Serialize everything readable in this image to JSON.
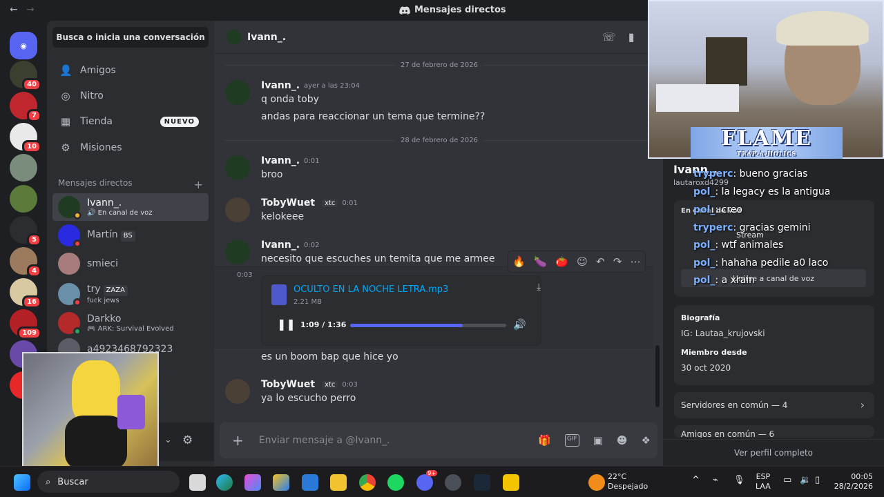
{
  "titlebar": {
    "back": "←",
    "forward": "→",
    "title": "Mensajes directos"
  },
  "servers": [
    {
      "badge": "",
      "color": "#5865f2",
      "icon": "discord-home-icon"
    },
    {
      "badge": "40",
      "color": "#3a3f2f"
    },
    {
      "badge": "7",
      "color": "#c0262d"
    },
    {
      "badge": "10",
      "color": "#e9e9e9"
    },
    {
      "badge": "",
      "color": "#7a8d7d"
    },
    {
      "badge": "",
      "color": "#5c7a3a"
    },
    {
      "badge": "5",
      "color": "#2b2d31"
    },
    {
      "badge": "4",
      "color": "#9c7a5e"
    },
    {
      "badge": "16",
      "color": "#d9c9a3"
    },
    {
      "badge": "109",
      "color": "#b32025"
    },
    {
      "badge": "",
      "color": "#6a4aa8"
    },
    {
      "badge": "",
      "color": "#e82828"
    }
  ],
  "sidebar": {
    "search": "Busca o inicia una conversación",
    "nav": [
      {
        "label": "Amigos",
        "icon": "friends-icon"
      },
      {
        "label": "Nitro",
        "icon": "nitro-icon"
      },
      {
        "label": "Tienda",
        "icon": "shop-icon",
        "badge": "NUEVO"
      },
      {
        "label": "Misiones",
        "icon": "quests-icon"
      }
    ],
    "dm_header": "Mensajes directos",
    "dm_add": "+",
    "dms": [
      {
        "name": "Ivann_.",
        "sub": "En canal de voz",
        "avatar": "#1f3b22",
        "status": "#f0b232"
      },
      {
        "name": "Martín",
        "tag": "BS",
        "sub": "",
        "avatar": "#2a2ae0",
        "status": "#f23f43"
      },
      {
        "name": "smieci",
        "sub": "",
        "avatar": "#a87c7c",
        "status": ""
      },
      {
        "name": "try",
        "tag": "ZAZA",
        "sub": "fuck jews",
        "avatar": "#6a8fa8",
        "status": "#f23f43"
      },
      {
        "name": "Darkko",
        "sub": "ARK: Survival Evolved",
        "avatar": "#b42a2a",
        "status": "#23a55a"
      },
      {
        "name": "a4923468792323",
        "sub": "",
        "avatar": "#5a5d66",
        "status": ""
      }
    ]
  },
  "chat": {
    "recipient": "Ivann_.",
    "dates": [
      "27 de febrero de 2026",
      "28 de febrero de 2026"
    ],
    "messages": [
      {
        "author": "Ivann_.",
        "time": "ayer a las 23:04",
        "lines": [
          "q onda toby",
          "andas para reaccionar un tema que termine??"
        ]
      },
      {
        "author": "Ivann_.",
        "time": "0:01",
        "lines": [
          "broo"
        ]
      },
      {
        "author": "TobyWuet",
        "tag": "xtc",
        "time": "0:01",
        "lines": [
          "kelokeee"
        ]
      },
      {
        "author": "Ivann_.",
        "time": "0:02",
        "lines": [
          "necesito que escuches un temita que me armee"
        ]
      },
      {
        "author": "TobyWuet",
        "tag": "xtc",
        "time": "0:03",
        "lines": [
          "ya lo escucho perro"
        ]
      }
    ],
    "hover_time": "0:03",
    "audio": {
      "filename": "OCULTO EN LA NOCHE LETRA.mp3",
      "size": "2.21 MB",
      "position": "1:09 / 1:36",
      "progress": 0.72
    },
    "after_audio": "es un boom bap que hice yo",
    "composer_placeholder": "Enviar mensaje a @Ivann_."
  },
  "profile": {
    "name_fragment": "Ivann_.",
    "username": "lautaroxd4299",
    "in_call": "En canal de voz",
    "stream": "Stream",
    "join_voice": "Unirse a canal de voz",
    "bio_label": "Biografía",
    "bio": "IG: Lautaa_krujovski",
    "member_label": "Miembro desde",
    "member_since": "30 oct 2020",
    "servers_common": "Servidores en común — 4",
    "friends_common": "Amigos en común — 6",
    "view_full": "Ver perfil completo"
  },
  "overlay": {
    "banner": "FLAME",
    "banner_sub": "TRAP-A-HOLICS",
    "chat": [
      {
        "user": "tryperc",
        "text": ": bueno gracias"
      },
      {
        "user": "pol_",
        "text": ": la legacy es la antigua"
      },
      {
        "user": "pol_",
        "text": ": creo"
      },
      {
        "user": "tryperc",
        "text": ": gracias gemini"
      },
      {
        "user": "pol_",
        "text": ": wtf animales"
      },
      {
        "user": "pol_",
        "text": ": hahaha pedile a0 laco"
      },
      {
        "user": "pol_",
        "text": ": a xrain"
      }
    ]
  },
  "taskbar": {
    "search": "Buscar",
    "weather_temp": "22°C",
    "weather_desc": "Despejado",
    "lang1": "ESP",
    "lang2": "LAA",
    "time": "00:05",
    "date": "28/2/2026",
    "discord_badge": "9+"
  }
}
